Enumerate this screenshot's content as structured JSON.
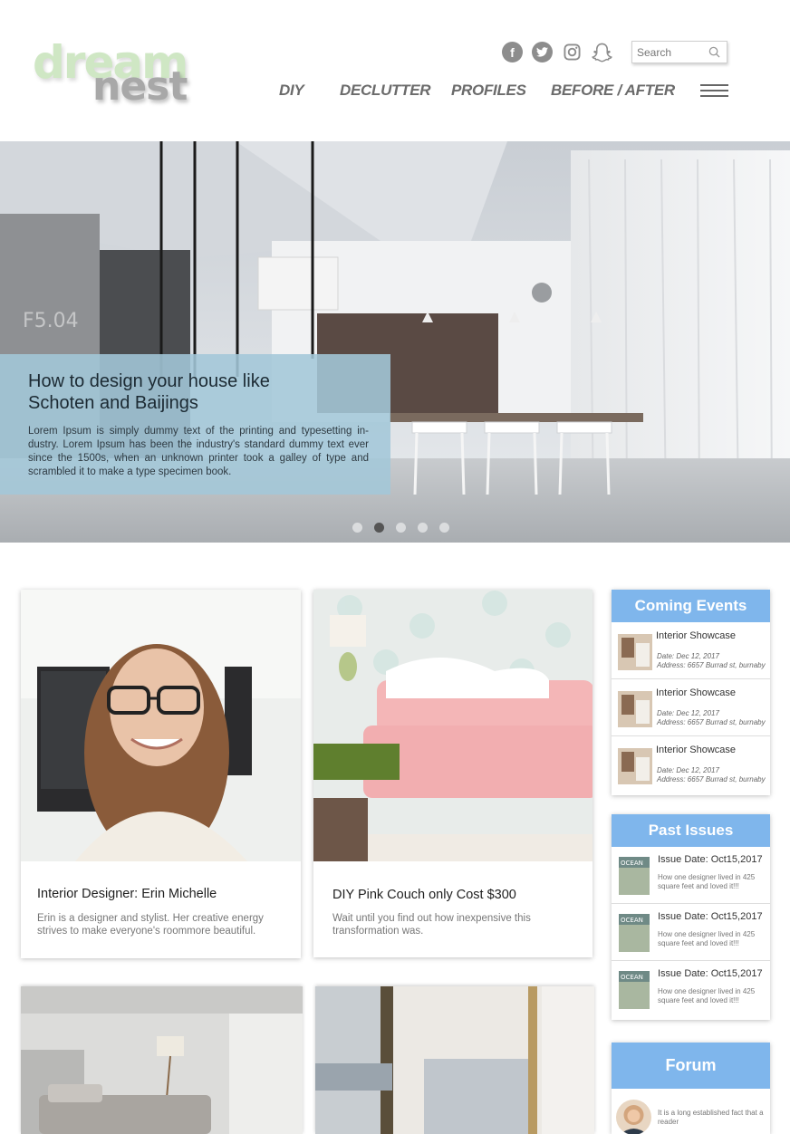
{
  "brand": {
    "line1": "dream",
    "line2": "nest"
  },
  "social": [
    {
      "icon": "facebook-icon",
      "glyph": "f"
    },
    {
      "icon": "twitter-icon",
      "glyph": ""
    },
    {
      "icon": "instagram-icon",
      "glyph": ""
    },
    {
      "icon": "snapchat-icon",
      "glyph": ""
    }
  ],
  "search": {
    "placeholder": "Search"
  },
  "nav": {
    "diy": "DIY",
    "declutter": "DECLUTTER",
    "profiles": "PROFILES",
    "before_after": "BEFORE / AFTER"
  },
  "hero": {
    "title": "How to design your house like Schoten and Baijings",
    "text": "Lorem Ipsum is simply dummy text of the printing and typesetting in-dustry. Lorem Ipsum has been the industry's standard dummy text ever since the 1500s, when an unknown printer took a galley of type and scrambled it to make a type specimen book.",
    "wall_label": "F5.04",
    "slides": 5,
    "active_slide": 2
  },
  "cards": [
    {
      "title": "Interior Designer:  Erin Michelle",
      "text": "Erin is a designer and stylist. Her creative energy strives to make everyone's roommore beautiful."
    },
    {
      "title": "DIY Pink Couch only Cost $300",
      "text": "Wait until you find out how inexpensive this transformation was."
    }
  ],
  "events": {
    "heading": "Coming Events",
    "items": [
      {
        "title": "Interior Showcase",
        "date": "Date: Dec 12, 2017",
        "address": "Address: 6657 Burrad st, burnaby"
      },
      {
        "title": "Interior Showcase",
        "date": "Date: Dec 12, 2017",
        "address": "Address: 6657 Burrad st, burnaby"
      },
      {
        "title": "Interior Showcase",
        "date": "Date: Dec 12, 2017",
        "address": "Address: 6657 Burrad st, burnaby"
      }
    ]
  },
  "issues": {
    "heading": "Past Issues",
    "items": [
      {
        "title": "Issue Date: Oct15,2017",
        "desc": "How one designer lived in 425 square feet and loved it!!!",
        "cover": "OCEAN"
      },
      {
        "title": "Issue Date: Oct15,2017",
        "desc": "How one designer lived in 425 square feet and loved it!!!",
        "cover": "OCEAN"
      },
      {
        "title": "Issue Date: Oct15,2017",
        "desc": "How one designer lived in 425 square feet and loved it!!!",
        "cover": "OCEAN"
      }
    ]
  },
  "forum": {
    "heading": "Forum",
    "text": "It is a long established fact that a reader"
  },
  "colors": {
    "accent": "#7fb6ec",
    "hero_overlay": "#a3c7d8",
    "nav_text": "#6b6b6b"
  }
}
